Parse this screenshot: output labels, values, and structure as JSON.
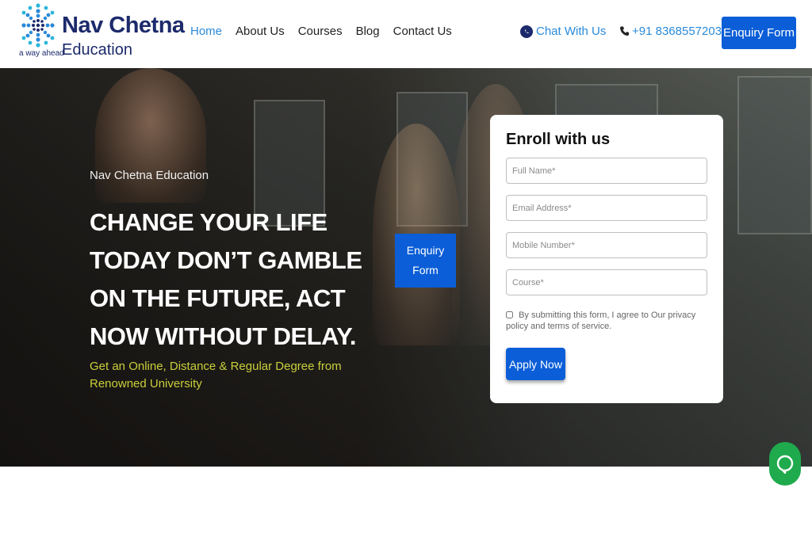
{
  "brand": {
    "name": "Nav Chetna",
    "sub": "Education",
    "tagline": "a way ahead"
  },
  "nav": {
    "items": [
      {
        "label": "Home",
        "active": true
      },
      {
        "label": "About Us",
        "active": false
      },
      {
        "label": "Courses",
        "active": false
      },
      {
        "label": "Blog",
        "active": false
      },
      {
        "label": "Contact Us",
        "active": false
      }
    ]
  },
  "header": {
    "chat_label": "Chat With Us",
    "phone": "+91 8368557203",
    "enquiry_label": "Enquiry Form"
  },
  "hero": {
    "subtitle": "Nav Chetna Education",
    "title": "CHANGE YOUR LIFE TODAY DON’T GAMBLE ON THE FUTURE, ACT NOW WITHOUT DELAY.",
    "description": "Get an Online, Distance & Regular Degree from Renowned University",
    "enquiry_label": "Enquiry Form"
  },
  "form": {
    "title": "Enroll with us",
    "full_name_placeholder": "Full Name*",
    "email_placeholder": "Email Address*",
    "mobile_placeholder": "Mobile Number*",
    "course_placeholder": "Course*",
    "consent_text": "By submitting this form, I agree to Our privacy policy and terms of service.",
    "submit_label": "Apply Now"
  },
  "colors": {
    "primary": "#0b5ed7",
    "link": "#2a8ad9",
    "brand_navy": "#1c2a6b",
    "accent_yellow": "#c9cf3a",
    "chat_green": "#1faa4d"
  },
  "icons": {
    "chat": "whatsapp-icon",
    "phone": "phone-icon",
    "floating_chat": "chat-bubble-icon"
  }
}
